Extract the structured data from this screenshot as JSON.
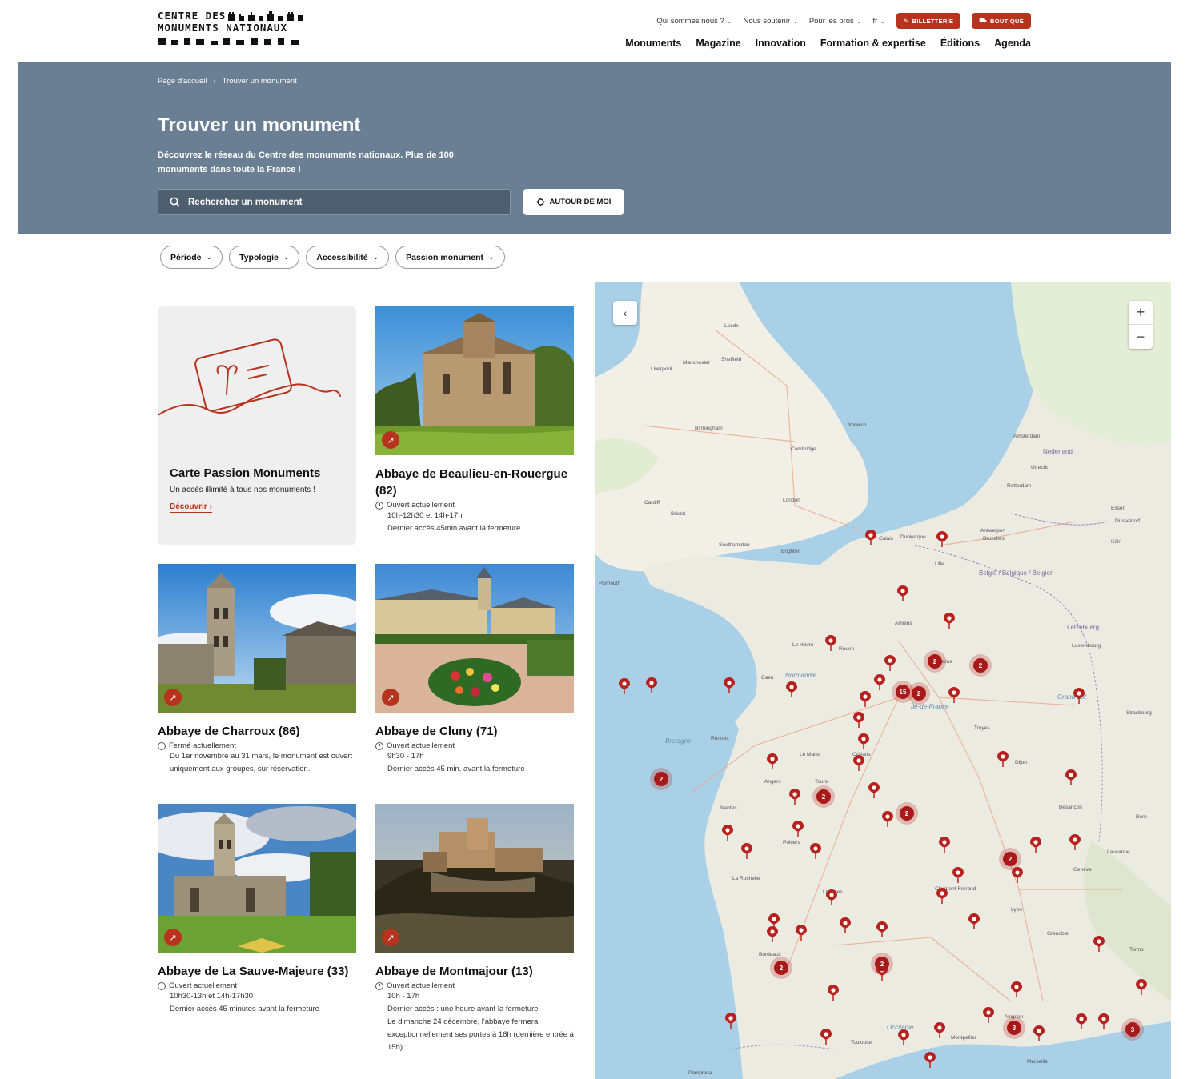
{
  "header": {
    "logo_line1": "CENTRE DES",
    "logo_line2": "MONUMENTS NATIONAUX",
    "topnav": [
      {
        "label": "Qui sommes nous ?"
      },
      {
        "label": "Nous soutenir"
      },
      {
        "label": "Pour les pros"
      },
      {
        "label": "fr"
      }
    ],
    "billetterie_label": "BILLETTERIE",
    "boutique_label": "BOUTIQUE",
    "mainnav": [
      "Monuments",
      "Magazine",
      "Innovation",
      "Formation & expertise",
      "Éditions",
      "Agenda"
    ]
  },
  "hero": {
    "breadcrumb_home": "Page d'accueil",
    "breadcrumb_sep": "›",
    "breadcrumb_current": "Trouver un monument",
    "title": "Trouver un monument",
    "subtitle": "Découvrez le réseau du Centre des monuments nationaux. Plus de 100 monuments dans toute la France !",
    "search_placeholder": "Rechercher un monument",
    "around_me_label": "AUTOUR DE MOI"
  },
  "filters": [
    "Période",
    "Typologie",
    "Accessibilité",
    "Passion monument"
  ],
  "pass_card": {
    "title": "Carte Passion Monuments",
    "desc": "Un accès illimité à tous nos monuments !",
    "link": "Découvrir"
  },
  "monuments": [
    {
      "title": "Abbaye de Beaulieu-en-Rouergue (82)",
      "status": "Ouvert actuellement",
      "info": [
        "10h-12h30 et 14h-17h",
        "Dernier accès 45min avant la fermeture"
      ]
    },
    {
      "title": "Abbaye de Charroux (86)",
      "status": "Fermé actuellement",
      "info": [
        "Du 1er novembre au 31 mars, le monument est ouvert uniquement aux groupes, sur réservation."
      ]
    },
    {
      "title": "Abbaye de Cluny (71)",
      "status": "Ouvert actuellement",
      "info": [
        "9h30 - 17h",
        "Dernier accès 45 min. avant la fermeture"
      ]
    },
    {
      "title": "Abbaye de La Sauve-Majeure (33)",
      "status": "Ouvert actuellement",
      "info": [
        "10h30-13h et 14h-17h30",
        "Dernier accès 45 minutes avant la fermeture"
      ]
    },
    {
      "title": "Abbaye de Montmajour (13)",
      "status": "Ouvert actuellement",
      "info": [
        "10h - 17h",
        "Dernier accès : une heure avant la fermeture",
        "Le dimanche 24 décembre, l'abbaye fermera exceptionnellement ses portes à 16h (dernière entrée à 15h)."
      ]
    }
  ],
  "map": {
    "zoom_in": "+",
    "zoom_out": "−",
    "clusters": [
      "15",
      "2",
      "2",
      "2",
      "2",
      "2",
      "2",
      "2",
      "2",
      "2",
      "3",
      "3"
    ],
    "cities": [
      "Leeds",
      "Manchester",
      "Sheffield",
      "Liverpool",
      "Birmingham",
      "Cambridge",
      "Norwich",
      "London",
      "Bristol",
      "Cardiff",
      "Brighton",
      "Southampton",
      "Lille",
      "Bruxelles",
      "Amsterdam",
      "Rotterdam",
      "Antwerpen",
      "Amiens",
      "Rouen",
      "Reims",
      "Rennes",
      "Nantes",
      "Orléans",
      "Tours",
      "Poitiers",
      "La Rochelle",
      "Limoges",
      "Bordeaux",
      "Toulouse",
      "Lyon",
      "Grenoble",
      "Marseille",
      "Strasbourg",
      "Dijon",
      "Besançon",
      "Luxembourg",
      "Genève",
      "Bern",
      "Le Havre",
      "Troyes",
      "Montpellier",
      "Clermont-Ferrand",
      "Avignon",
      "Le Mans",
      "Angers",
      "Caen",
      "Calais",
      "Dunkerque",
      "Köln",
      "Düsseldorf",
      "Essen",
      "Utrecht",
      "Lausanne",
      "Torino",
      "Pamplona",
      "Plymouth"
    ],
    "countries": [
      "Nederland",
      "België / Belgique / Belgien",
      "Letzebuerg",
      "Normandie",
      "Bretagne",
      "Île-de-France",
      "Grand Est",
      "Occitanie"
    ]
  }
}
